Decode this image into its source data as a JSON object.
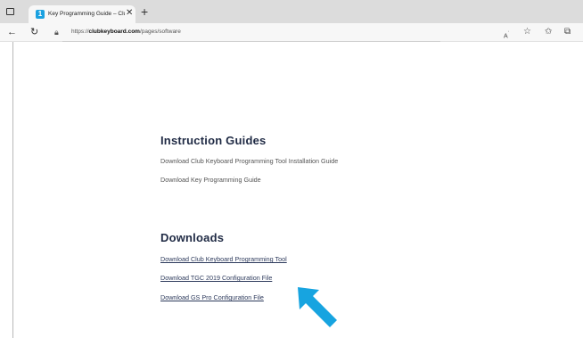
{
  "browser": {
    "tab_title": "Key Programming Guide – Club I",
    "favicon_glyph": "1",
    "url_prefix": "https://",
    "url_domain": "clubkeyboard.com",
    "url_path": "/pages/software"
  },
  "icons": {
    "back": "back-arrow-icon",
    "refresh": "refresh-icon",
    "lock": "lock-icon",
    "read_aloud": "read-aloud-icon",
    "favorite": "star-icon",
    "favorites_bar": "favorites-icon",
    "collections": "collections-icon"
  },
  "instruction_guides": {
    "heading": "Instruction Guides",
    "links": [
      "Download Club Keyboard Programming Tool Installation Guide",
      "Download Key Programming Guide"
    ]
  },
  "downloads": {
    "heading": "Downloads",
    "links": [
      "Download Club Keyboard Programming Tool",
      "Download TGC 2019 Configuration File",
      "Download GS Pro Configuration File"
    ]
  },
  "colors": {
    "heading": "#1f2a44",
    "link": "#2d3a5c",
    "arrow": "#17a4e0"
  }
}
